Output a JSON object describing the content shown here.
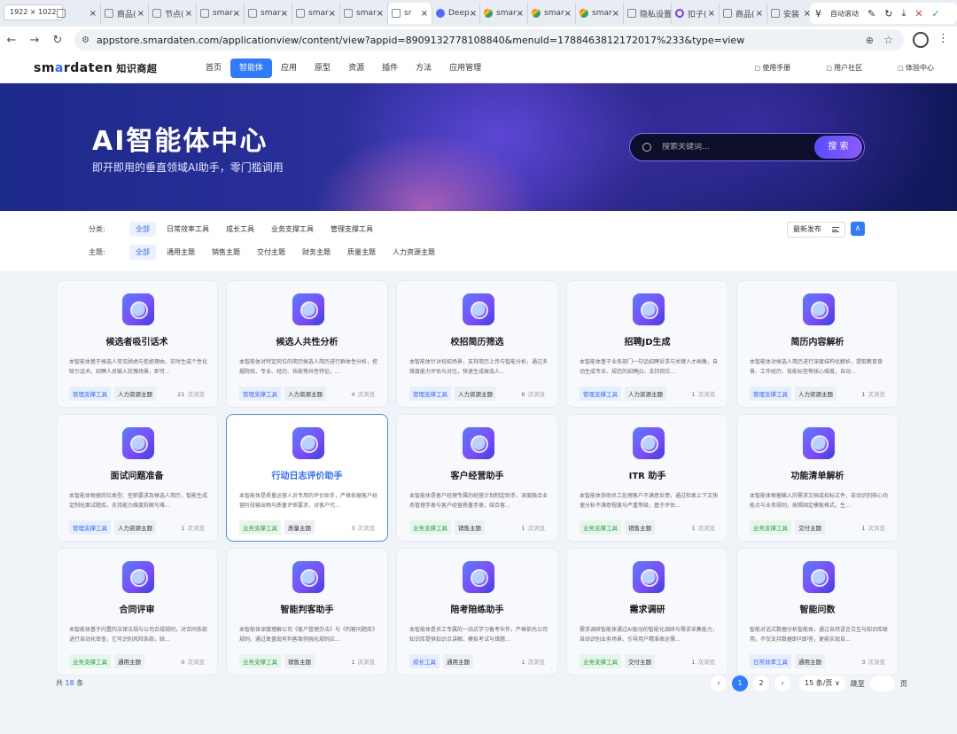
{
  "browser": {
    "dims_badge": "1922 × 1022",
    "tabs": [
      {
        "label": "",
        "fav": "doc"
      },
      {
        "label": "商品(",
        "fav": "doc"
      },
      {
        "label": "节点(",
        "fav": "doc"
      },
      {
        "label": "smar",
        "fav": "doc"
      },
      {
        "label": "smar",
        "fav": "doc"
      },
      {
        "label": "smar",
        "fav": "doc"
      },
      {
        "label": "smar",
        "fav": "doc"
      },
      {
        "label": "sr",
        "fav": "doc",
        "active": true
      },
      {
        "label": "Deep",
        "fav": "d"
      },
      {
        "label": "smar",
        "fav": "g"
      },
      {
        "label": "smar",
        "fav": "g"
      },
      {
        "label": "smar",
        "fav": "g"
      },
      {
        "label": "隐私设置",
        "fav": "doc"
      },
      {
        "label": "扣子(",
        "fav": "p"
      },
      {
        "label": "商品(",
        "fav": "doc"
      },
      {
        "label": "安装",
        "fav": "doc"
      }
    ],
    "auto_scroll": "自动滚动",
    "url": "appstore.smardaten.com/applicationview/content/view?appid=8909132778108840&menuId=1788463812172017%233&type=view"
  },
  "header": {
    "logo_a": "sm",
    "logo_o": "a",
    "logo_b": "rdaten",
    "logo_sub": "知识商超",
    "nav": [
      "首页",
      "智能体",
      "应用",
      "原型",
      "资源",
      "插件",
      "方法",
      "应用管理"
    ],
    "active_nav": 1,
    "links": [
      "使用手册",
      "用户社区",
      "体验中心"
    ]
  },
  "banner": {
    "title": "AI智能体中心",
    "subtitle": "即开即用的垂直领域AI助手，零门槛调用",
    "search_placeholder": "搜索关键词...",
    "search_button": "搜 索"
  },
  "filters": {
    "category_label": "分类:",
    "categories": [
      "全部",
      "日常效率工具",
      "成长工具",
      "业务支撑工具",
      "管理支撑工具"
    ],
    "theme_label": "主题:",
    "themes": [
      "全部",
      "通用主题",
      "销售主题",
      "交付主题",
      "财务主题",
      "质量主题",
      "人力资源主题"
    ],
    "sort": "最新发布"
  },
  "views_suffix": "次浏览",
  "cards": [
    {
      "title": "候选者吸引话术",
      "desc": "本智能体基于候选人常见顾虑与拒绝理由，实时生成个性化吸引话术。招聘人员输入犹豫场景，即可...",
      "tag1": "管理支撑工具",
      "tag1c": "t-mgmt",
      "tag2": "人力资源主题",
      "views": "21"
    },
    {
      "title": "候选人共性分析",
      "desc": "本智能体对特定岗位的简历候选人简历进行群体性分析，挖掘院校、专业、经历、技能等共性特征。...",
      "tag1": "管理支撑工具",
      "tag1c": "t-mgmt",
      "tag2": "人力资源主题",
      "views": "4"
    },
    {
      "title": "校招简历筛选",
      "desc": "本智能体针对校招场景，支持简历上传与智能分析，通过多维度能力评估与对比，快速生成候选人...",
      "tag1": "管理支撑工具",
      "tag1c": "t-mgmt",
      "tag2": "人力资源主题",
      "views": "6"
    },
    {
      "title": "招聘JD生成",
      "desc": "本智能体基于业务部门一句话招聘诉求与关键人才画像，自动生成专业、规范的招聘JD。支持岗位...",
      "tag1": "管理支撑工具",
      "tag1c": "t-mgmt",
      "tag2": "人力资源主题",
      "views": "1"
    },
    {
      "title": "简历内容解析",
      "desc": "本智能体对候选人简历进行深度结构化解析，提取教育背景、工作经历、技能标签等核心维度，自动...",
      "tag1": "管理支撑工具",
      "tag1c": "t-mgmt",
      "tag2": "人力资源主题",
      "views": "1"
    },
    {
      "title": "面试问题准备",
      "desc": "本智能体根据岗位类型、任职要求及候选人简历，智能生成定制化面试题库。支持能力维度拆解与难...",
      "tag1": "管理支撑工具",
      "tag1c": "t-mgmt",
      "tag2": "人力资源主题",
      "views": "1"
    },
    {
      "title": "行动日志评价助手",
      "desc": "本智能体是质量运营人员专用的评价助手，严格依据客户经营阶段输出物与质量评审要求，对客户代...",
      "tag1": "业务支撑工具",
      "tag1c": "t-biz",
      "tag2": "质量主题",
      "views": "3",
      "highlight": true
    },
    {
      "title": "客户经营助手",
      "desc": "本智能体是客户经理专属的经营计划制定助手，深度融合业务管理手册与客户经营质量手册，结合客...",
      "tag1": "业务支撑工具",
      "tag1c": "t-biz",
      "tag2": "销售主题",
      "views": "1"
    },
    {
      "title": "ITR 助手",
      "desc": "本智能体协助员工处理客户不满意反馈，通过检索上下文快速分析不满意程度与严重等级，基于评估...",
      "tag1": "业务支撑工具",
      "tag1c": "t-biz",
      "tag2": "销售主题",
      "views": "1"
    },
    {
      "title": "功能清单解析",
      "desc": "本智能体根据输入的需求文档或招标文件，自动识别核心功能点与业务规则，按照固定模板格式，生...",
      "tag1": "业务支撑工具",
      "tag1c": "t-biz",
      "tag2": "交付主题",
      "views": "1"
    },
    {
      "title": "合同评审",
      "desc": "本智能体基于内置的法律法规与公司合规规则，对合同条款进行自动化审查，它可识别风险条款、缺...",
      "tag1": "业务支撑工具",
      "tag1c": "t-biz",
      "tag2": "通用主题",
      "views": "0"
    },
    {
      "title": "智能判客助手",
      "desc": "本智能体深度理解公司《客户管理办法》与《判客问题库》规则，通过复盘现有判客案例强化规则应...",
      "tag1": "业务支撑工具",
      "tag1c": "t-biz",
      "tag2": "销售主题",
      "views": "1"
    },
    {
      "title": "陪考陪练助手",
      "desc": "本智能体是员工专属的一站式学习备考伙伴，严格依托公司知识库提供知识点讲解、模拟考试与错题...",
      "tag1": "成长工具",
      "tag1c": "t-grow",
      "tag2": "通用主题",
      "views": "1"
    },
    {
      "title": "需求调研",
      "desc": "需求调研智能体通过AI驱动的智能化调研与需求采集能力，自动识别业务场景、引导用户精准表达需...",
      "tag1": "业务支撑工具",
      "tag1c": "t-biz",
      "tag2": "交付主题",
      "views": "1"
    },
    {
      "title": "智能问数",
      "desc": "智能对话式数据分析智能体，通过自然语言交互与知识库联用，不仅支持数据即问即答，更能实现自...",
      "tag1": "日常效率工具",
      "tag1c": "t-daily",
      "tag2": "通用主题",
      "views": "3"
    }
  ],
  "pagination": {
    "total_prefix": "共",
    "total": "18",
    "total_suffix": "条",
    "pages": [
      "1",
      "2"
    ],
    "page_size": "15 条/页 ∨",
    "jump_label": "跳至",
    "page_unit": "页"
  }
}
